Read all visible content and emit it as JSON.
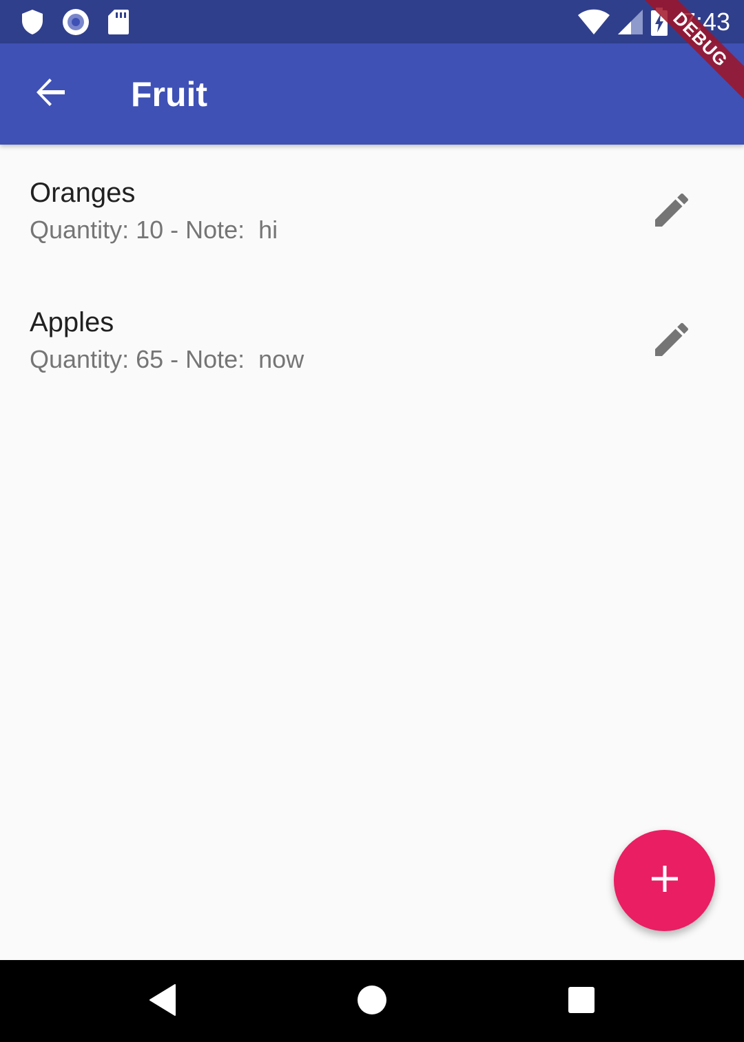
{
  "status_bar": {
    "time": "7:43",
    "icons": [
      "shield-icon",
      "record-icon",
      "sd-card-icon",
      "wifi-icon",
      "signal-icon",
      "battery-charging-icon"
    ]
  },
  "app_bar": {
    "title": "Fruit",
    "back_icon": "arrow-back-icon"
  },
  "debug_banner": {
    "label": "DEBUG"
  },
  "items": [
    {
      "title": "Oranges",
      "subtitle": "Quantity: 10 - Note:  hi",
      "action_icon": "edit-icon"
    },
    {
      "title": "Apples",
      "subtitle": "Quantity: 65 - Note:  now",
      "action_icon": "edit-icon"
    }
  ],
  "fab": {
    "icon": "add-icon"
  },
  "nav_bar": {
    "icons": [
      "back-triangle-icon",
      "home-circle-icon",
      "recents-square-icon"
    ]
  },
  "colors": {
    "status_bar": "#303f8c",
    "app_bar": "#3f51b5",
    "fab": "#e91e63",
    "background": "#fafafa",
    "title_text": "#212121",
    "subtitle_text": "#757575",
    "icon_grey": "#757575"
  }
}
